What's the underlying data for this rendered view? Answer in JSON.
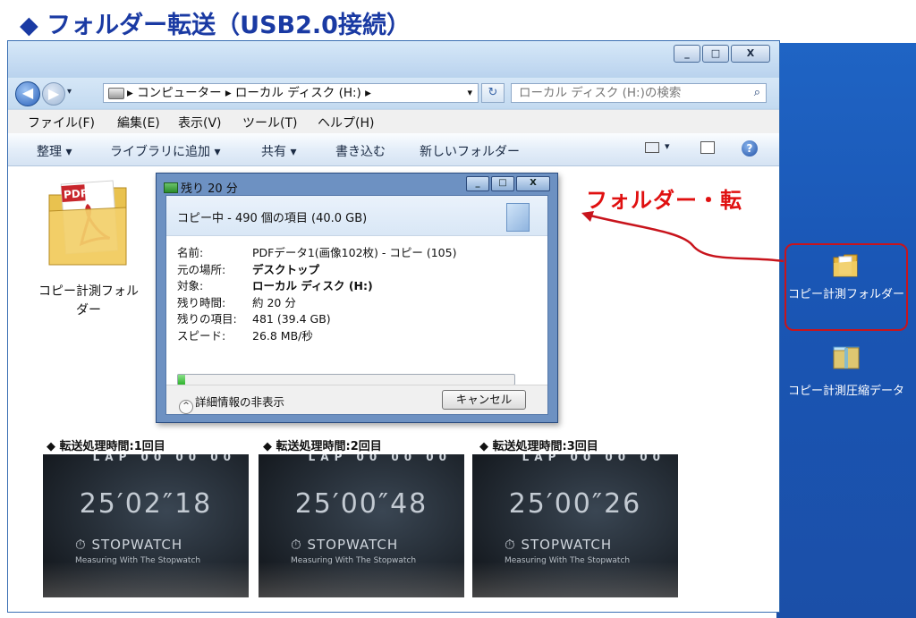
{
  "page": {
    "title": "◆ フォルダー転送（USB2.0接続）",
    "annotation": "フォルダー・転"
  },
  "window": {
    "buttons": {
      "minimize": "_",
      "maximize": "□",
      "close": "X"
    }
  },
  "nav": {
    "back_glyph": "◀",
    "forward_glyph": "▶",
    "address_path": "▸ コンピューター ▸ ローカル ディスク (H:) ▸",
    "address_dropdown": "▾",
    "refresh_glyph": "↻",
    "search_placeholder": "ローカル ディスク (H:)の検索"
  },
  "menubar": {
    "items": [
      "ファイル(F)",
      "編集(E)",
      "表示(V)",
      "ツール(T)",
      "ヘルプ(H)"
    ]
  },
  "toolbar": {
    "items": [
      "整理 ▾",
      "ライブラリに追加 ▾",
      "共有 ▾",
      "書き込む",
      "新しいフォルダー"
    ]
  },
  "content": {
    "folder_label": "コピー計測フォルダー"
  },
  "dialog": {
    "title": "残り 20 分",
    "header": "コピー中 - 490 個の項目 (40.0 GB)",
    "rows": [
      {
        "key": "名前:",
        "value": "PDFデータ1(画像102枚) - コピー (105)"
      },
      {
        "key": "元の場所:",
        "value": "デスクトップ"
      },
      {
        "key": "対象:",
        "value": "ローカル ディスク (H:)"
      },
      {
        "key": "残り時間:",
        "value": "約 20 分"
      },
      {
        "key": "残りの項目:",
        "value": "481 (39.4 GB)"
      },
      {
        "key": "スピード:",
        "value": "26.8 MB/秒"
      }
    ],
    "progress": 0.02,
    "details_toggle": "詳細情報の非表示",
    "cancel": "キャンセル"
  },
  "desktop": {
    "icons": [
      {
        "label": "コピー計測フォルダー"
      },
      {
        "label": "コピー計測圧縮データ"
      }
    ]
  },
  "stopwatch": [
    {
      "label": "◆ 転送処理時間:1回目",
      "time": "25′02″18"
    },
    {
      "label": "◆ 転送処理時間:2回目",
      "time": "25′00″48"
    },
    {
      "label": "◆ 転送処理時間:3回目",
      "time": "25′00″26"
    }
  ],
  "stopwatch_common": {
    "brand": "STOPWATCH",
    "sub": "Measuring With The Stopwatch",
    "top": "LAP 00 00 00"
  },
  "colors": {
    "title": "#1a3aa3",
    "annotation": "#e01010",
    "desktop": "#1b56b5",
    "selection": "#c8141c"
  }
}
